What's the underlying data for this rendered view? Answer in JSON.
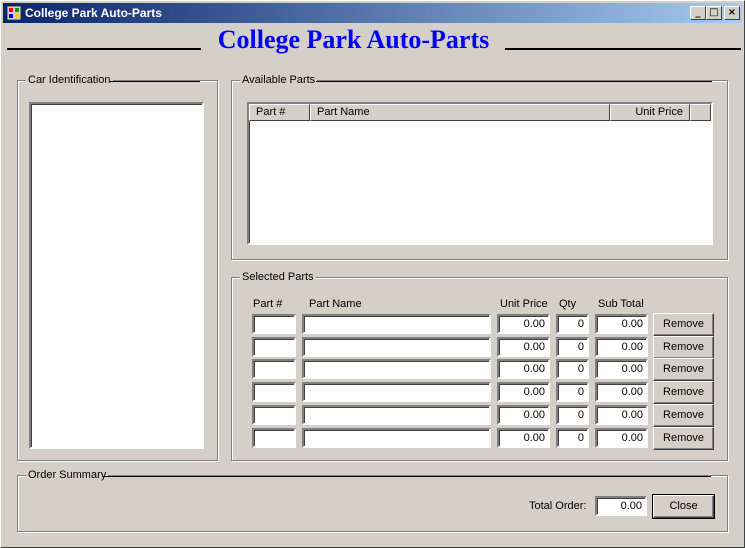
{
  "window": {
    "title": "College Park Auto-Parts",
    "caption_buttons": [
      "_",
      "□",
      "×"
    ]
  },
  "header": {
    "title": "College Park Auto-Parts",
    "title_color": "#0000ff"
  },
  "car_identification": {
    "label": "Car Identification"
  },
  "available_parts": {
    "label": "Available Parts",
    "columns": [
      "Part #",
      "Part Name",
      "Unit Price"
    ]
  },
  "selected_parts": {
    "label": "Selected Parts",
    "columns": {
      "part_no": "Part #",
      "part_name": "Part Name",
      "unit_price": "Unit Price",
      "qty": "Qty",
      "sub_total": "Sub Total"
    },
    "remove_label": "Remove",
    "rows": [
      {
        "part_no": "",
        "part_name": "",
        "unit_price": "0.00",
        "qty": "0",
        "sub_total": "0.00"
      },
      {
        "part_no": "",
        "part_name": "",
        "unit_price": "0.00",
        "qty": "0",
        "sub_total": "0.00"
      },
      {
        "part_no": "",
        "part_name": "",
        "unit_price": "0.00",
        "qty": "0",
        "sub_total": "0.00"
      },
      {
        "part_no": "",
        "part_name": "",
        "unit_price": "0.00",
        "qty": "0",
        "sub_total": "0.00"
      },
      {
        "part_no": "",
        "part_name": "",
        "unit_price": "0.00",
        "qty": "0",
        "sub_total": "0.00"
      },
      {
        "part_no": "",
        "part_name": "",
        "unit_price": "0.00",
        "qty": "0",
        "sub_total": "0.00"
      }
    ]
  },
  "order_summary": {
    "label": "Order Summary",
    "total_label": "Total Order:",
    "total_value": "0.00",
    "close_label": "Close"
  }
}
